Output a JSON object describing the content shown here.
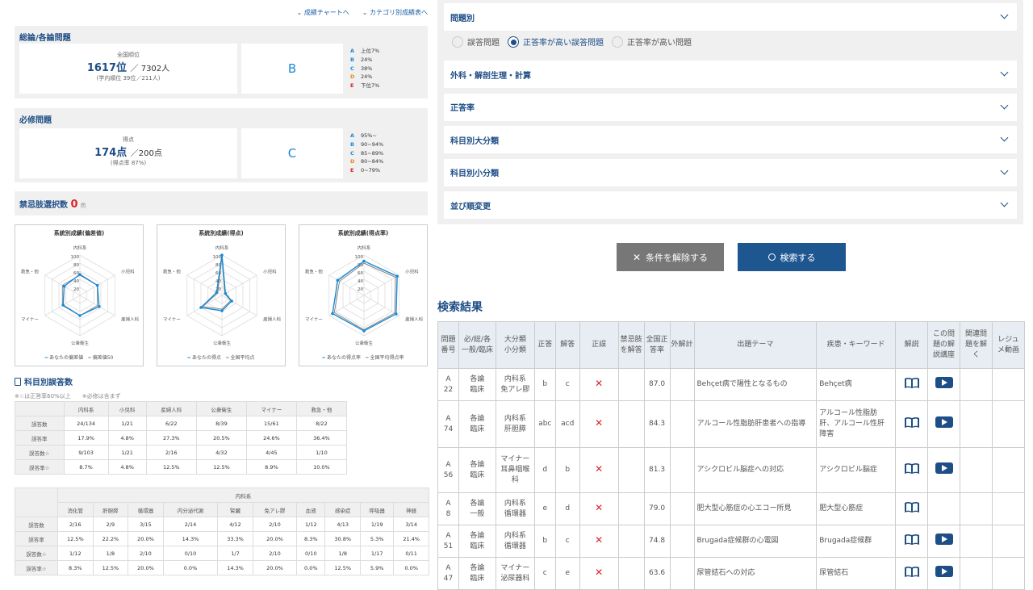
{
  "links": {
    "chart": "⌄ 成績チャートへ",
    "category": "⌄ カテゴリ別成績表へ"
  },
  "sougou": {
    "title": "総論/各論問題",
    "rank_label": "全国順位",
    "rank_value": "1617位",
    "rank_total": "／ 7302人",
    "rank_school": "(学内順位 39位／211人)",
    "grade": "B",
    "legend": [
      {
        "l": "A",
        "t": "上位7%",
        "color": "#1a8ad4"
      },
      {
        "l": "B",
        "t": "24%",
        "color": "#1a8ad4"
      },
      {
        "l": "C",
        "t": "38%",
        "color": "#1a8ad4"
      },
      {
        "l": "D",
        "t": "24%",
        "color": "#e08a1e"
      },
      {
        "l": "E",
        "t": "下位7%",
        "color": "#d9252a"
      }
    ]
  },
  "hisshu": {
    "title": "必修問題",
    "score_label": "得点",
    "score_value": "174点",
    "score_total": "／200点",
    "score_rate": "(得点率 87%)",
    "grade": "C",
    "legend": [
      {
        "l": "A",
        "t": "95%~",
        "color": "#1a8ad4"
      },
      {
        "l": "B",
        "t": "90~94%",
        "color": "#1a8ad4"
      },
      {
        "l": "C",
        "t": "85~89%",
        "color": "#1a8ad4"
      },
      {
        "l": "D",
        "t": "80~84%",
        "color": "#e08a1e"
      },
      {
        "l": "E",
        "t": "0~79%",
        "color": "#d9252a"
      }
    ]
  },
  "kinshi": {
    "label": "禁忌肢選択数",
    "count": "0",
    "unit": "問"
  },
  "chart_data": [
    {
      "type": "radar",
      "title": "系統別成績(偏差値)",
      "axes": [
        "内科系",
        "小児科",
        "産婦人科",
        "公衆衛生",
        "マイナー",
        "救急・他"
      ],
      "ticks": [
        "100",
        "80",
        "60",
        "40",
        "20"
      ],
      "rmax": 100,
      "series": [
        {
          "name": "あなたの偏差値",
          "values": [
            52,
            50,
            55,
            50,
            48,
            45
          ]
        },
        {
          "name": "偏差値50",
          "values": [
            50,
            50,
            50,
            50,
            50,
            50
          ]
        }
      ]
    },
    {
      "type": "radar",
      "title": "系統別成績(得点)",
      "axes": [
        "内科系",
        "小児科",
        "産婦人科",
        "公衆衛生",
        "マイナー",
        "救急・他"
      ],
      "ticks": [
        "100",
        "80",
        "60",
        "40",
        "20"
      ],
      "rmax": 100,
      "series": [
        {
          "name": "あなたの得点",
          "values": [
            100,
            10,
            28,
            38,
            60,
            15
          ]
        },
        {
          "name": "全国平均点",
          "values": [
            95,
            8,
            25,
            34,
            55,
            12
          ]
        }
      ]
    },
    {
      "type": "radar",
      "title": "系統別成績(得点率)",
      "axes": [
        "内科系",
        "小児科",
        "産婦人科",
        "公衆衛生",
        "マイナー",
        "救急・他"
      ],
      "ticks": [
        "100",
        "80",
        "60",
        "40",
        "20"
      ],
      "rmax": 100,
      "series": [
        {
          "name": "あなたの得点率",
          "values": [
            85,
            95,
            92,
            88,
            90,
            75
          ]
        },
        {
          "name": "全国平均得点率",
          "values": [
            80,
            90,
            88,
            85,
            85,
            70
          ]
        }
      ]
    }
  ],
  "kamoku": {
    "title": "科目別誤答数",
    "note": "※☆は正答率60%以上　　※必修は含まず",
    "headers": [
      "",
      "内科系",
      "小児科",
      "産婦人科",
      "公衆衛生",
      "マイナー",
      "救急・他"
    ],
    "rows": [
      [
        "誤答数",
        "24/134",
        "1/21",
        "6/22",
        "8/39",
        "15/61",
        "8/22"
      ],
      [
        "誤答率",
        "17.9%",
        "4.8%",
        "27.3%",
        "20.5%",
        "24.6%",
        "36.4%"
      ],
      [
        "誤答数☆",
        "9/103",
        "1/21",
        "2/16",
        "4/32",
        "4/45",
        "1/10"
      ],
      [
        "誤答率☆",
        "8.7%",
        "4.8%",
        "12.5%",
        "12.5%",
        "8.9%",
        "10.0%"
      ]
    ]
  },
  "naika": {
    "group": "内科系",
    "headers": [
      "",
      "消化管",
      "肝胆膵",
      "循環器",
      "内分泌代謝",
      "腎臓",
      "免アレ膠",
      "血液",
      "感染症",
      "呼吸器",
      "神経"
    ],
    "rows": [
      [
        "誤答数",
        "2/16",
        "2/9",
        "3/15",
        "2/14",
        "4/12",
        "2/10",
        "1/12",
        "4/13",
        "1/19",
        "3/14"
      ],
      [
        "誤答率",
        "12.5%",
        "22.2%",
        "20.0%",
        "14.3%",
        "33.3%",
        "20.0%",
        "8.3%",
        "30.8%",
        "5.3%",
        "21.4%"
      ],
      [
        "誤答数☆",
        "1/12",
        "1/8",
        "2/10",
        "0/10",
        "1/7",
        "2/10",
        "0/10",
        "1/8",
        "1/17",
        "0/11"
      ],
      [
        "誤答率☆",
        "8.3%",
        "12.5%",
        "20.0%",
        "0.0%",
        "14.3%",
        "20.0%",
        "0.0%",
        "12.5%",
        "5.9%",
        "0.0%"
      ]
    ]
  },
  "filters": {
    "mondai": "問題別",
    "radios": [
      "誤答問題",
      "正答率が高い誤答問題",
      "正答率が高い問題"
    ],
    "items": [
      "外科・解剖生理・計算",
      "正答率",
      "科目別大分類",
      "科目別小分類",
      "並び順変更"
    ]
  },
  "buttons": {
    "clear": "条件を解除する",
    "search": "検索する"
  },
  "results": {
    "title": "検索結果",
    "headers": [
      "問題\n番号",
      "必/総/各\n一般/臨床",
      "大分類\n小分類",
      "正答",
      "解答",
      "正誤",
      "禁忌肢\nを解答",
      "全国正\n答率",
      "外解計",
      "出題テーマ",
      "疾患・キーワード",
      "解説",
      "この問\n題の解\n説講座",
      "関連問\n題を解\nく",
      "レジュ\nメ動画"
    ],
    "rows": [
      {
        "no": "A\n22",
        "type": "各論\n臨床",
        "cat": "内科系\n免アレ膠",
        "ans": "b",
        "mine": "c",
        "rate": "87.0",
        "theme": "Behçet病で陽性となるもの",
        "kw": "Behçet病",
        "video": true
      },
      {
        "no": "A\n74",
        "type": "各論\n臨床",
        "cat": "内科系\n肝胆膵",
        "ans": "abc",
        "mine": "acd",
        "rate": "84.3",
        "theme": "アルコール性脂肪肝患者への指導",
        "kw": "アルコール性脂肪\n肝、アルコール性肝\n障害",
        "video": true
      },
      {
        "no": "A\n56",
        "type": "各論\n臨床",
        "cat": "マイナー\n耳鼻咽喉\n科",
        "ans": "d",
        "mine": "b",
        "rate": "81.3",
        "theme": "アシクロビル脳症への対応",
        "kw": "アシクロビル脳症",
        "video": true
      },
      {
        "no": "A\n8",
        "type": "各論\n一般",
        "cat": "内科系\n循環器",
        "ans": "e",
        "mine": "d",
        "rate": "79.0",
        "theme": "肥大型心筋症の心エコー所見",
        "kw": "肥大型心筋症",
        "video": false
      },
      {
        "no": "A\n51",
        "type": "各論\n臨床",
        "cat": "内科系\n循環器",
        "ans": "b",
        "mine": "c",
        "rate": "74.8",
        "theme": "Brugada症候群の心電図",
        "kw": "Brugada症候群",
        "video": true
      },
      {
        "no": "A\n47",
        "type": "各論\n臨床",
        "cat": "マイナー\n泌尿器科",
        "ans": "c",
        "mine": "e",
        "rate": "63.6",
        "theme": "尿管結石への対応",
        "kw": "尿管結石",
        "video": true
      }
    ]
  }
}
